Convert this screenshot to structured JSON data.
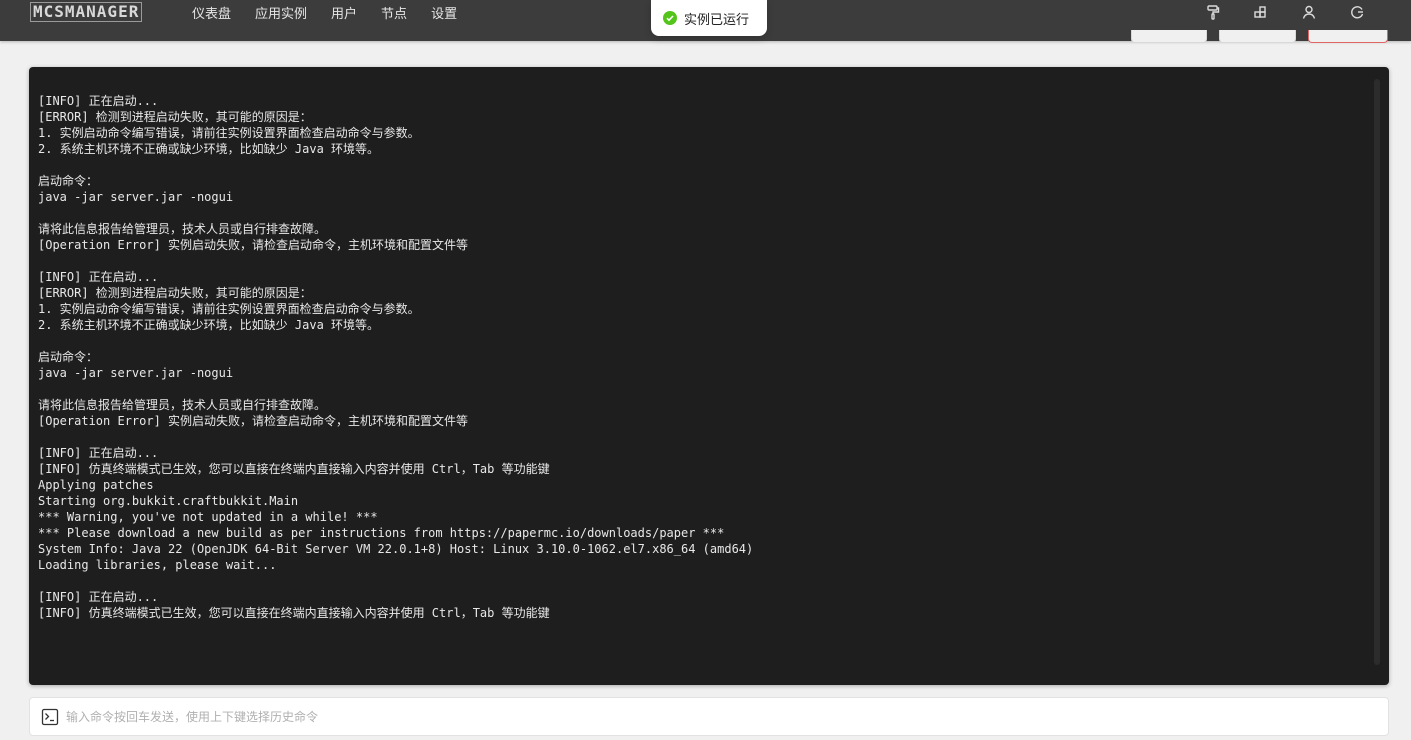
{
  "header": {
    "logo": "MCSMANAGER",
    "nav": [
      "仪表盘",
      "应用实例",
      "用户",
      "节点",
      "设置"
    ],
    "right_icons": [
      "paint-roller-icon",
      "layout-icon",
      "user-icon",
      "logout-icon"
    ]
  },
  "toast": {
    "message": "实例已运行",
    "status": "success",
    "color": "#52c41a"
  },
  "terminal": {
    "lines": [
      "[INFO] 正在启动...",
      "[ERROR] 检测到进程启动失败，其可能的原因是：",
      "1. 实例启动命令编写错误，请前往实例设置界面检查启动命令与参数。",
      "2. 系统主机环境不正确或缺少环境，比如缺少 Java 环境等。",
      "",
      "启动命令：",
      "java -jar server.jar -nogui",
      "",
      "请将此信息报告给管理员，技术人员或自行排查故障。",
      "[Operation Error] 实例启动失败，请检查启动命令，主机环境和配置文件等",
      "",
      "[INFO] 正在启动...",
      "[ERROR] 检测到进程启动失败，其可能的原因是：",
      "1. 实例启动命令编写错误，请前往实例设置界面检查启动命令与参数。",
      "2. 系统主机环境不正确或缺少环境，比如缺少 Java 环境等。",
      "",
      "启动命令：",
      "java -jar server.jar -nogui",
      "",
      "请将此信息报告给管理员，技术人员或自行排查故障。",
      "[Operation Error] 实例启动失败，请检查启动命令，主机环境和配置文件等",
      "",
      "[INFO] 正在启动...",
      "[INFO] 仿真终端模式已生效，您可以直接在终端内直接输入内容并使用 Ctrl，Tab 等功能键",
      "Applying patches",
      "Starting org.bukkit.craftbukkit.Main",
      "*** Warning, you've not updated in a while! ***",
      "*** Please download a new build as per instructions from https://papermc.io/downloads/paper ***",
      "System Info: Java 22 (OpenJDK 64-Bit Server VM 22.0.1+8) Host: Linux 3.10.0-1062.el7.x86_64 (amd64)",
      "Loading libraries, please wait...",
      "",
      "[INFO] 正在启动...",
      "[INFO] 仿真终端模式已生效，您可以直接在终端内直接输入内容并使用 Ctrl，Tab 等功能键"
    ]
  },
  "command_input": {
    "placeholder": "输入命令按回车发送，使用上下键选择历史命令",
    "value": "",
    "icon": "terminal-prompt-icon"
  }
}
